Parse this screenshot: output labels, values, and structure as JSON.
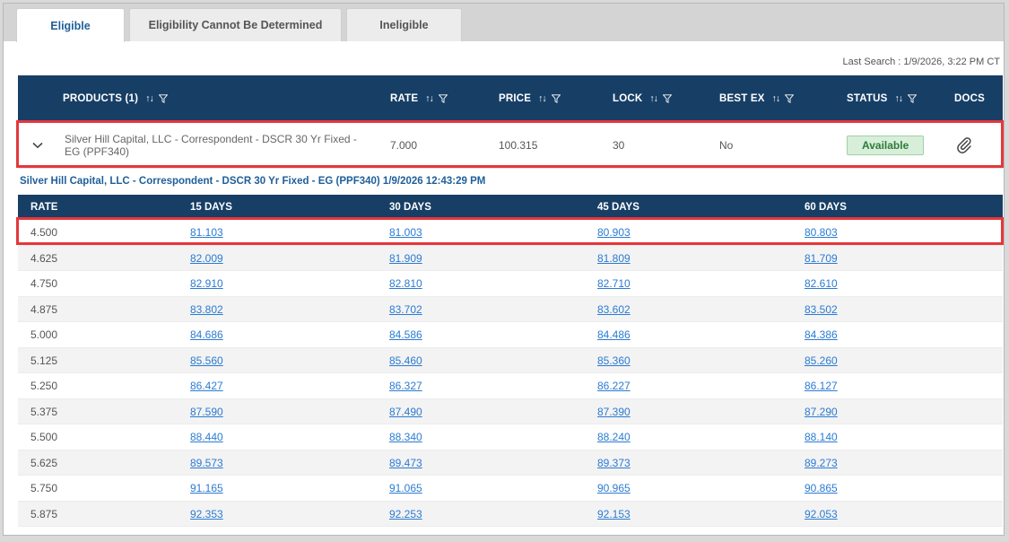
{
  "tabs": [
    {
      "label": "Eligible"
    },
    {
      "label": "Eligibility Cannot Be Determined"
    },
    {
      "label": "Ineligible"
    }
  ],
  "last_search": "Last Search : 1/9/2026, 3:22 PM CT",
  "products_table": {
    "headers": {
      "products": "PRODUCTS (1)",
      "rate": "RATE",
      "price": "PRICE",
      "lock": "LOCK",
      "best_ex": "BEST EX",
      "status": "STATUS",
      "docs": "DOCS"
    },
    "row": {
      "product_name": "Silver Hill Capital, LLC - Correspondent - DSCR 30 Yr Fixed - EG (PPF340)",
      "rate": "7.000",
      "price": "100.315",
      "lock": "30",
      "best_ex": "No",
      "status": "Available",
      "status_color": "#2e7a3a"
    }
  },
  "detail": {
    "title": "Silver Hill Capital, LLC - Correspondent - DSCR 30 Yr Fixed - EG (PPF340) 1/9/2026 12:43:29 PM",
    "headers": {
      "rate": "RATE",
      "d15": "15 DAYS",
      "d30": "30 DAYS",
      "d45": "45 DAYS",
      "d60": "60 DAYS"
    },
    "rows": [
      {
        "rate": "4.500",
        "d15": "81.103",
        "d30": "81.003",
        "d45": "80.903",
        "d60": "80.803"
      },
      {
        "rate": "4.625",
        "d15": "82.009",
        "d30": "81.909",
        "d45": "81.809",
        "d60": "81.709"
      },
      {
        "rate": "4.750",
        "d15": "82.910",
        "d30": "82.810",
        "d45": "82.710",
        "d60": "82.610"
      },
      {
        "rate": "4.875",
        "d15": "83.802",
        "d30": "83.702",
        "d45": "83.602",
        "d60": "83.502"
      },
      {
        "rate": "5.000",
        "d15": "84.686",
        "d30": "84.586",
        "d45": "84.486",
        "d60": "84.386"
      },
      {
        "rate": "5.125",
        "d15": "85.560",
        "d30": "85.460",
        "d45": "85.360",
        "d60": "85.260"
      },
      {
        "rate": "5.250",
        "d15": "86.427",
        "d30": "86.327",
        "d45": "86.227",
        "d60": "86.127"
      },
      {
        "rate": "5.375",
        "d15": "87.590",
        "d30": "87.490",
        "d45": "87.390",
        "d60": "87.290"
      },
      {
        "rate": "5.500",
        "d15": "88.440",
        "d30": "88.340",
        "d45": "88.240",
        "d60": "88.140"
      },
      {
        "rate": "5.625",
        "d15": "89.573",
        "d30": "89.473",
        "d45": "89.373",
        "d60": "89.273"
      },
      {
        "rate": "5.750",
        "d15": "91.165",
        "d30": "91.065",
        "d45": "90.965",
        "d60": "90.865"
      },
      {
        "rate": "5.875",
        "d15": "92.353",
        "d30": "92.253",
        "d45": "92.153",
        "d60": "92.053"
      }
    ]
  },
  "colors": {
    "header_bg": "#173f66",
    "highlight": "#e5373c",
    "link": "#2b7bd3"
  },
  "icons": {
    "sort": "sort-icon",
    "filter": "filter-icon",
    "expand": "chevron-down-icon",
    "docs": "paperclip-icon"
  }
}
